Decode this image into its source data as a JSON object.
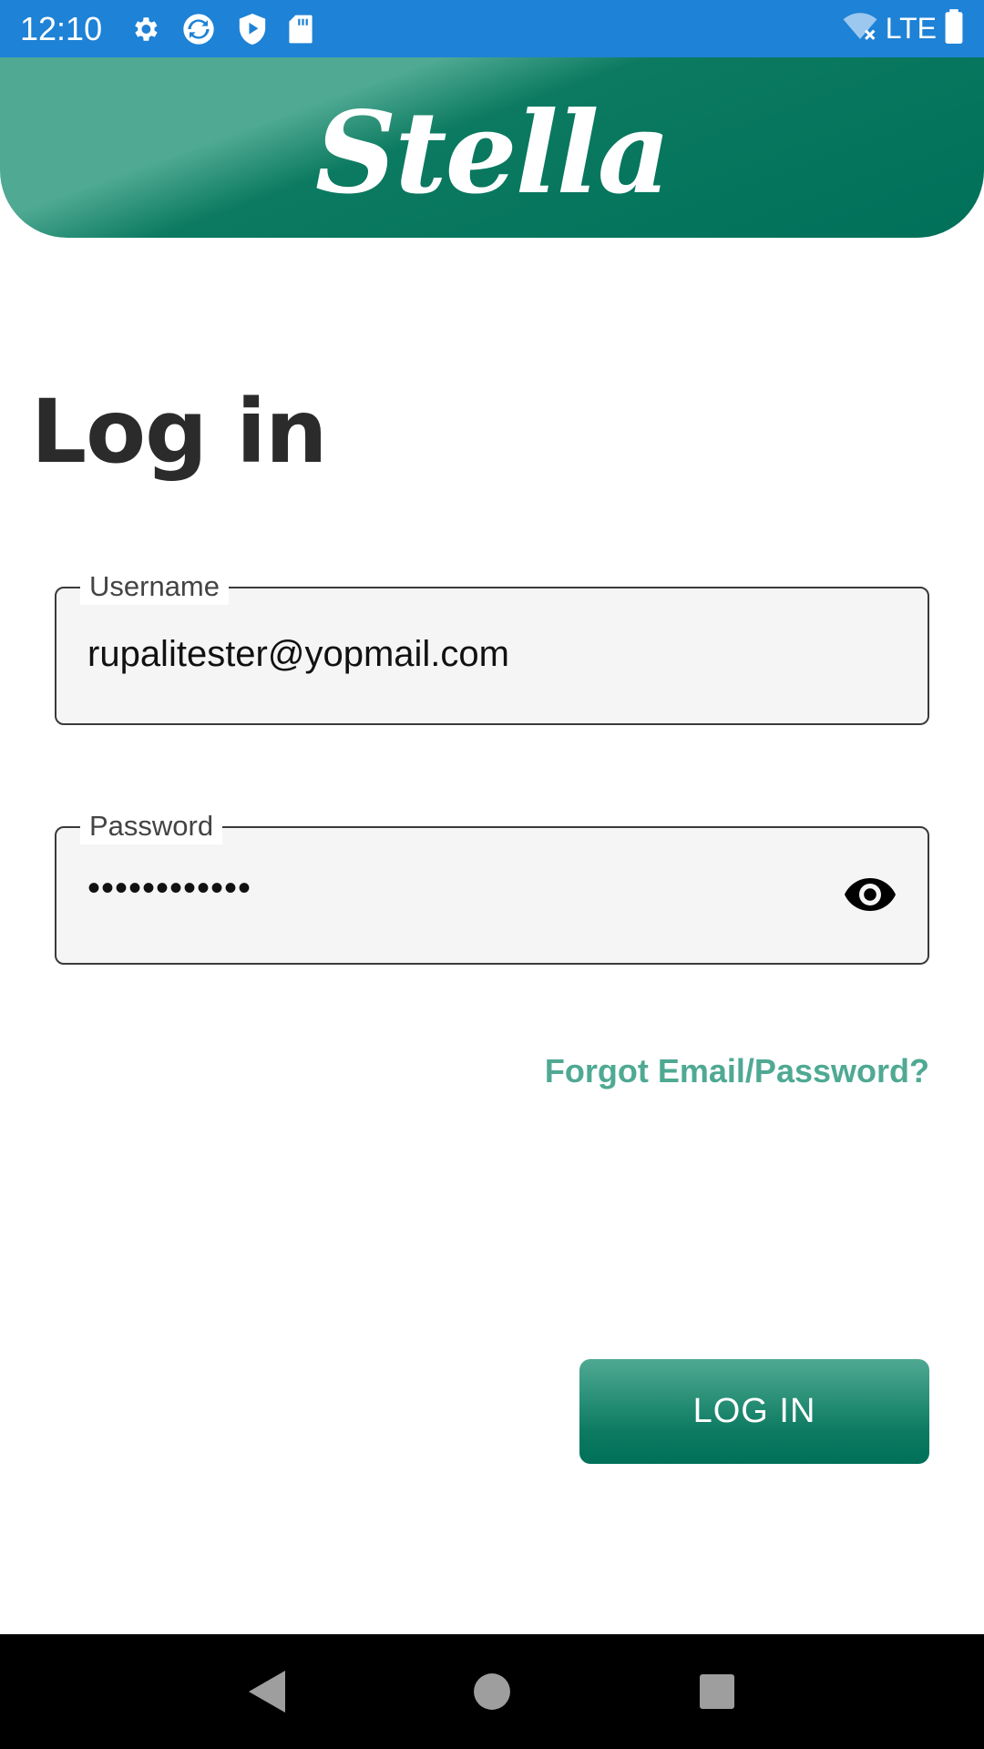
{
  "status_bar": {
    "time": "12:10",
    "network": "LTE",
    "icons": [
      "settings-icon",
      "sync-icon",
      "shield-play-icon",
      "sd-card-icon",
      "wifi-off-icon",
      "battery-icon"
    ]
  },
  "header": {
    "brand": "Stella"
  },
  "page": {
    "title": "Log in"
  },
  "form": {
    "username": {
      "label": "Username",
      "value": "rupalitester@yopmail.com"
    },
    "password": {
      "label": "Password",
      "value": "••••••••••••",
      "toggle_icon": "eye-icon"
    },
    "forgot_link": "Forgot Email/Password?",
    "submit_label": "LOG IN"
  },
  "nav_bar": {
    "buttons": [
      "back-icon",
      "home-icon",
      "recents-icon"
    ]
  },
  "colors": {
    "status_bar": "#1e82d6",
    "brand_dark": "#00705a",
    "brand_light": "#4fa993",
    "text_dark": "#2b2b2b"
  }
}
